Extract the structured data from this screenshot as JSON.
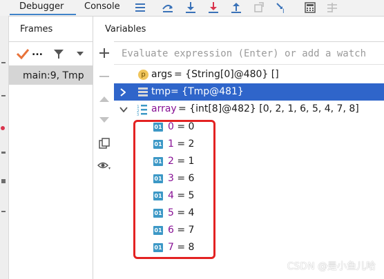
{
  "tabs": {
    "debugger": "Debugger",
    "console": "Console"
  },
  "frames": {
    "header": "Frames",
    "current_frame": "main:9, Tmp",
    "filter_label": "..."
  },
  "variables": {
    "header": "Variables",
    "eval_placeholder": "Evaluate expression (Enter) or add a watch",
    "rows": [
      {
        "badge": "p",
        "name": "args",
        "value": " = {String[0]@480} []"
      },
      {
        "name": "tmp",
        "value": " = {Tmp@481}"
      },
      {
        "name": "array",
        "value": " = {int[8]@482} [0, 2, 1, 6, 5, 4, 7, 8]"
      }
    ],
    "elements": [
      {
        "index": "0",
        "value": " = 0"
      },
      {
        "index": "1",
        "value": " = 2"
      },
      {
        "index": "2",
        "value": " = 1"
      },
      {
        "index": "3",
        "value": " = 6"
      },
      {
        "index": "4",
        "value": " = 5"
      },
      {
        "index": "5",
        "value": " = 4"
      },
      {
        "index": "6",
        "value": " = 7"
      },
      {
        "index": "7",
        "value": " = 8"
      }
    ],
    "element_badge": "01"
  },
  "watermark": "CSDN @是小鱼儿哈",
  "colors": {
    "selection": "#2f65ca",
    "highlight_box": "#e32222",
    "var_name": "#871094",
    "element_badge": "#3c98c6"
  }
}
